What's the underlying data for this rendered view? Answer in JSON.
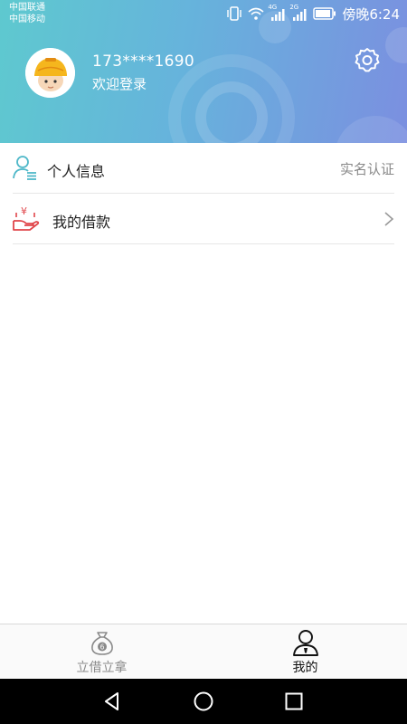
{
  "status_bar": {
    "carrier_1": "中国联通",
    "carrier_2": "中国移动",
    "signal_label_1": "4G",
    "signal_label_2": "2G",
    "time": "傍晚6:24"
  },
  "profile": {
    "phone": "173****1690",
    "welcome": "欢迎登录"
  },
  "menu": {
    "items": [
      {
        "label": "个人信息",
        "right_text": "实名认证",
        "icon": "user-info-icon"
      },
      {
        "label": "我的借款",
        "right_text": "",
        "icon": "loan-hand-icon"
      }
    ]
  },
  "tabbar": {
    "tabs": [
      {
        "label": "立借立拿",
        "icon": "money-bag-icon",
        "active": false
      },
      {
        "label": "我的",
        "icon": "user-icon",
        "active": true
      }
    ]
  },
  "colors": {
    "header_start": "#5ec9cf",
    "header_end": "#7b8fe0",
    "accent_teal": "#4fb8c9",
    "loan_red": "#e0454a",
    "tab_inactive": "#8a8a8a",
    "tab_active": "#111111"
  }
}
